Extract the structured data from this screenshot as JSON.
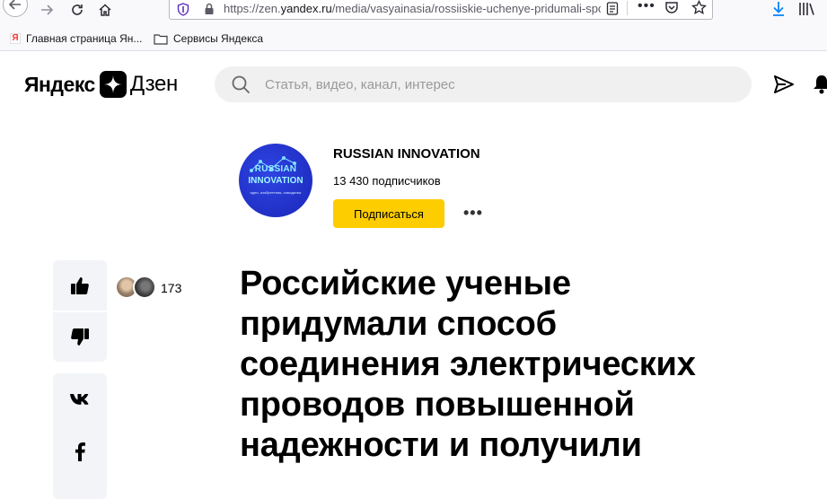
{
  "browser": {
    "url_prefix": "https://zen.",
    "url_host": "yandex.ru",
    "url_path": "/media/vasyainasia/rossiiskie-uchenye-pridumali-sposob",
    "more_glyph": "•••"
  },
  "bookmarks": [
    {
      "label": "Главная страница Ян...",
      "icon": "yandex-favicon",
      "favicon_letter": "Я"
    },
    {
      "label": "Сервисы Яндекса",
      "icon": "folder-icon"
    }
  ],
  "header": {
    "logo_left": "Яндекс",
    "logo_right": "Дзен",
    "search_placeholder": "Статья, видео, канал, интерес"
  },
  "channel": {
    "name": "RUSSIAN INNOVATION",
    "subscribers": "13 430 подписчиков",
    "subscribe_label": "Подписаться",
    "more_glyph": "•••",
    "avatar_line1": "RUSSIAN",
    "avatar_line2": "INNOVATION",
    "avatar_line3": "идеи, изобретения, самоделки"
  },
  "reactions": {
    "like_count": "173"
  },
  "article": {
    "title": "Российские ученые придумали способ соединения электрических проводов повышенной надежности и получили"
  },
  "colors": {
    "accent_yellow": "#fdcd00",
    "rail_bg": "#f2f4f8",
    "search_bg": "#f0f0f0",
    "download_blue": "#0a84ff"
  }
}
